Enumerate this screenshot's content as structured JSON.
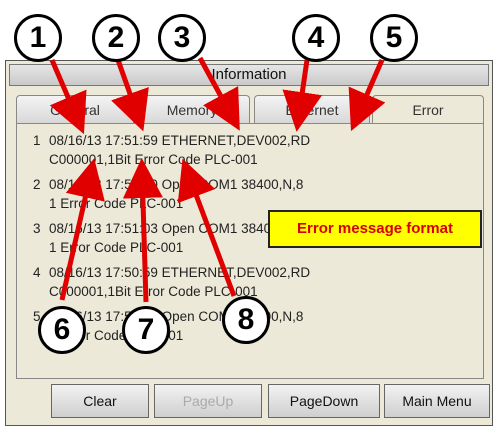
{
  "window": {
    "title": "Information"
  },
  "tabs": [
    {
      "label": "General",
      "active": false
    },
    {
      "label": "Memory",
      "active": false
    },
    {
      "label": "Ethernet",
      "active": false
    },
    {
      "label": "Error",
      "active": true
    }
  ],
  "log": [
    {
      "num": "1",
      "line1": "08/16/13 17:51:59 ETHERNET,DEV002,RD",
      "line2": "C000001,1Bit Error Code PLC-001"
    },
    {
      "num": "2",
      "line1": "08/16/13 17:51:10 Open COM1 38400,N,8",
      "line2": "1 Error Code PLC-001"
    },
    {
      "num": "3",
      "line1": "08/16/13 17:51:03 Open COM1 38400,N,8",
      "line2": "1 Error Code PLC-001"
    },
    {
      "num": "4",
      "line1": "08/16/13 17:50:59 ETHERNET,DEV002,RD",
      "line2": "C000001,1Bit Error Code PLC-001"
    },
    {
      "num": "5",
      "line1": "08/16/13 17:50:56 Open COM1 38400,N,8",
      "line2": "1 Error Code PLC-001"
    }
  ],
  "callout": {
    "text": "Error message format",
    "text_color": "#d80000",
    "bg_color": "#ffff00"
  },
  "buttons": {
    "clear": "Clear",
    "page_up": "PageUp",
    "page_down": "PageDown",
    "main_menu": "Main Menu"
  },
  "badges": [
    "1",
    "2",
    "3",
    "4",
    "5",
    "6",
    "7",
    "8"
  ],
  "arrow_color": "#e00000"
}
